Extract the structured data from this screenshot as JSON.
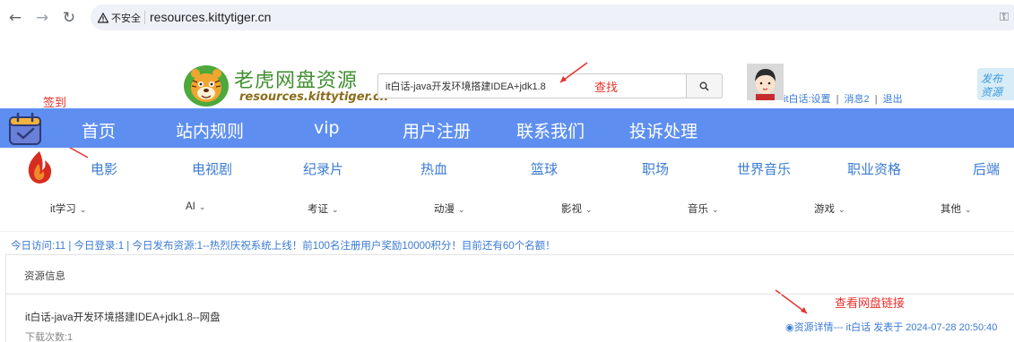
{
  "browser": {
    "security_label": "不安全",
    "url": "resources.kittytiger.cn"
  },
  "header": {
    "site_name": "老虎网盘资源",
    "site_url": "resources.kittytiger.cn",
    "search_value": "it白话-java开发环境搭建IDEA+jdk1.8",
    "user": {
      "username_settings": "it白话:设置",
      "messages": "消息2",
      "logout": "退出",
      "sep": "|"
    },
    "publish_badge": "发布资源"
  },
  "annotations": {
    "checkin": "签到",
    "search": "查找",
    "view_link": "查看网盘链接"
  },
  "main_nav": [
    "首页",
    "站内规则",
    "vip",
    "用户注册",
    "联系我们",
    "投诉处理"
  ],
  "categories": [
    "电影",
    "电视剧",
    "纪录片",
    "热血",
    "篮球",
    "职场",
    "世界音乐",
    "职业资格",
    "后端"
  ],
  "subcategories": [
    "it学习",
    "AI",
    "考证",
    "动漫",
    "影视",
    "音乐",
    "游戏",
    "其他"
  ],
  "ticker": "今日访问:11 | 今日登录:1 | 今日发布资源:1--热烈庆祝系统上线！前100名注册用户奖励10000积分！目前还有60个名额！",
  "panel": {
    "title": "资源信息",
    "resource_title": "it白话-java开发环境搭建IDEA+jdk1.8--网盘",
    "downloads": "下载次数:1",
    "meta": "◉资源详情--- it白话 发表于 2024-07-28 20:50:40"
  },
  "colors": {
    "nav_bg": "#5e8ff0",
    "link": "#3b7bd3",
    "annotation": "#e8312b"
  }
}
